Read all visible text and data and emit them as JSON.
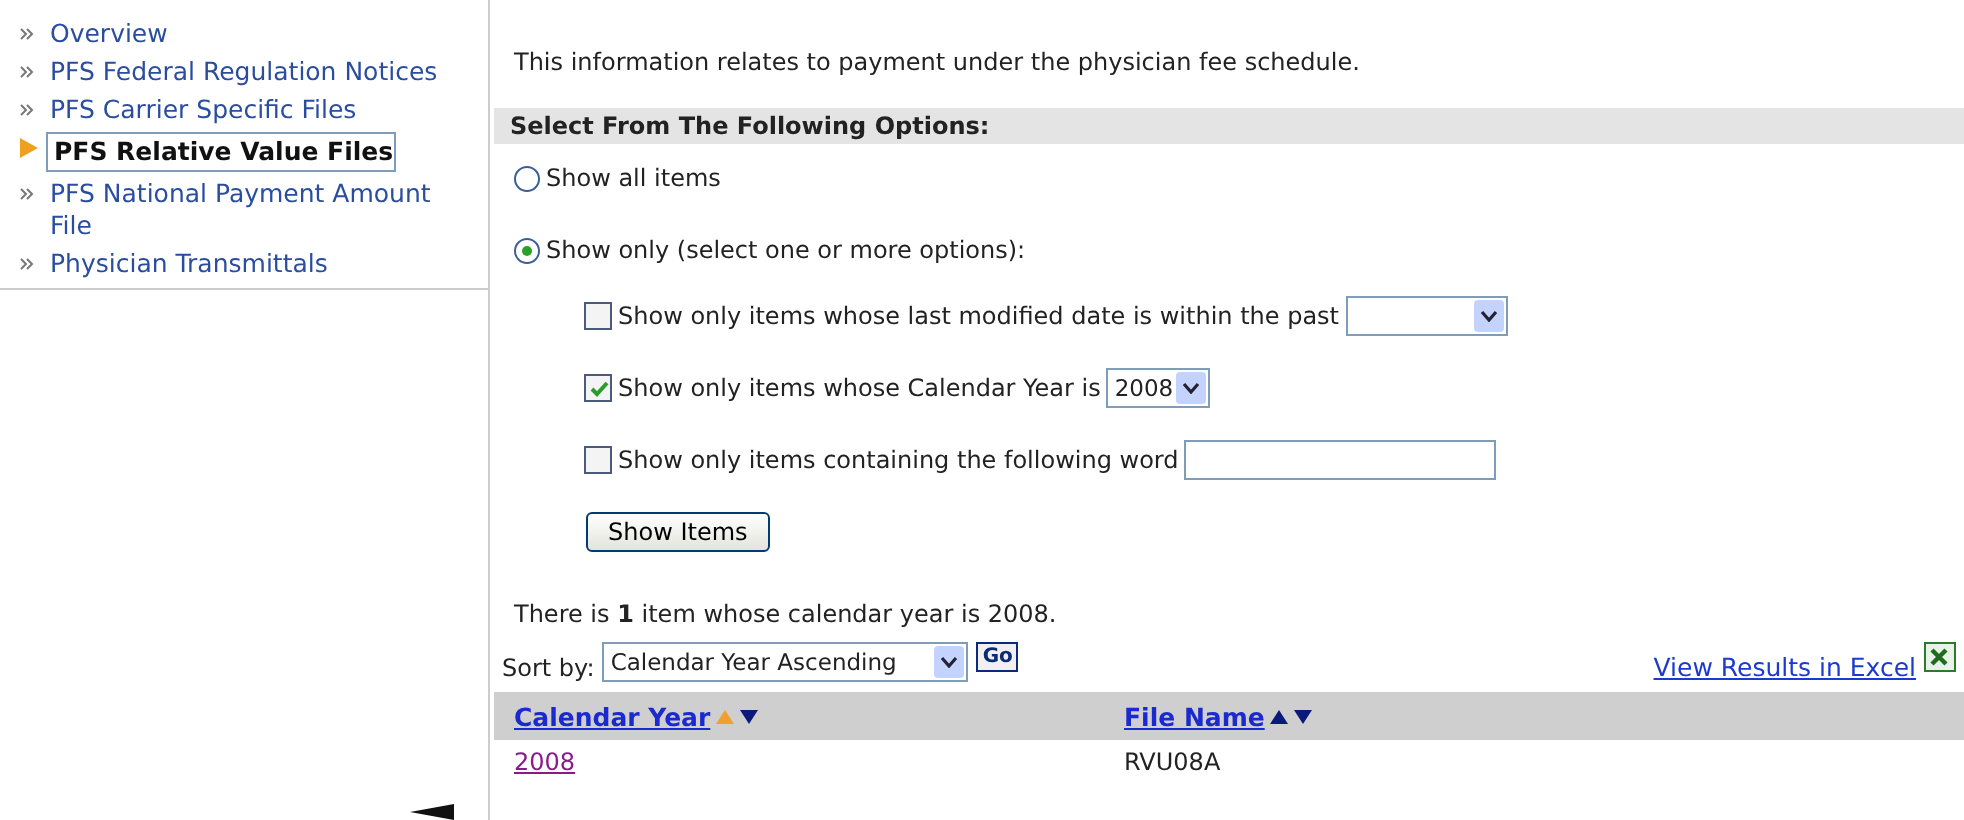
{
  "sidebar": {
    "items": [
      {
        "label": "Overview",
        "selected": false
      },
      {
        "label": "PFS Federal Regulation Notices",
        "selected": false
      },
      {
        "label": "PFS Carrier Specific Files",
        "selected": false
      },
      {
        "label": "PFS Relative Value Files",
        "selected": true
      },
      {
        "label": "PFS National Payment Amount File",
        "selected": false
      },
      {
        "label": "Physician Transmittals",
        "selected": false
      }
    ]
  },
  "intro": "This information relates to payment under the physician fee schedule.",
  "options": {
    "heading": "Select From The Following Options:",
    "radios": [
      {
        "label": "Show all items",
        "selected": false
      },
      {
        "label": "Show only (select one or more options):",
        "selected": true
      }
    ],
    "filters": [
      {
        "kind": "select",
        "label": "Show only items whose last modified date is within the past",
        "checked": false
      },
      {
        "kind": "select",
        "label": "Show only items whose Calendar Year is",
        "checked": true,
        "value": "2008"
      },
      {
        "kind": "text",
        "label": "Show only items containing the following word",
        "checked": false
      }
    ],
    "button": "Show Items"
  },
  "summary": "There is **1** item whose calendar year is 2008.",
  "sort": {
    "label": "Sort by:",
    "value": "Calendar Year Ascending",
    "go": "Go"
  },
  "excel_link": "View Results in Excel",
  "table": {
    "columns": [
      {
        "label": "Calendar Year",
        "sorted_ascending": true
      },
      {
        "label": "File Name",
        "sorted_ascending": false
      }
    ],
    "rows": [
      {
        "calendar_year": "2008",
        "file_name": "RVU08A"
      }
    ]
  }
}
